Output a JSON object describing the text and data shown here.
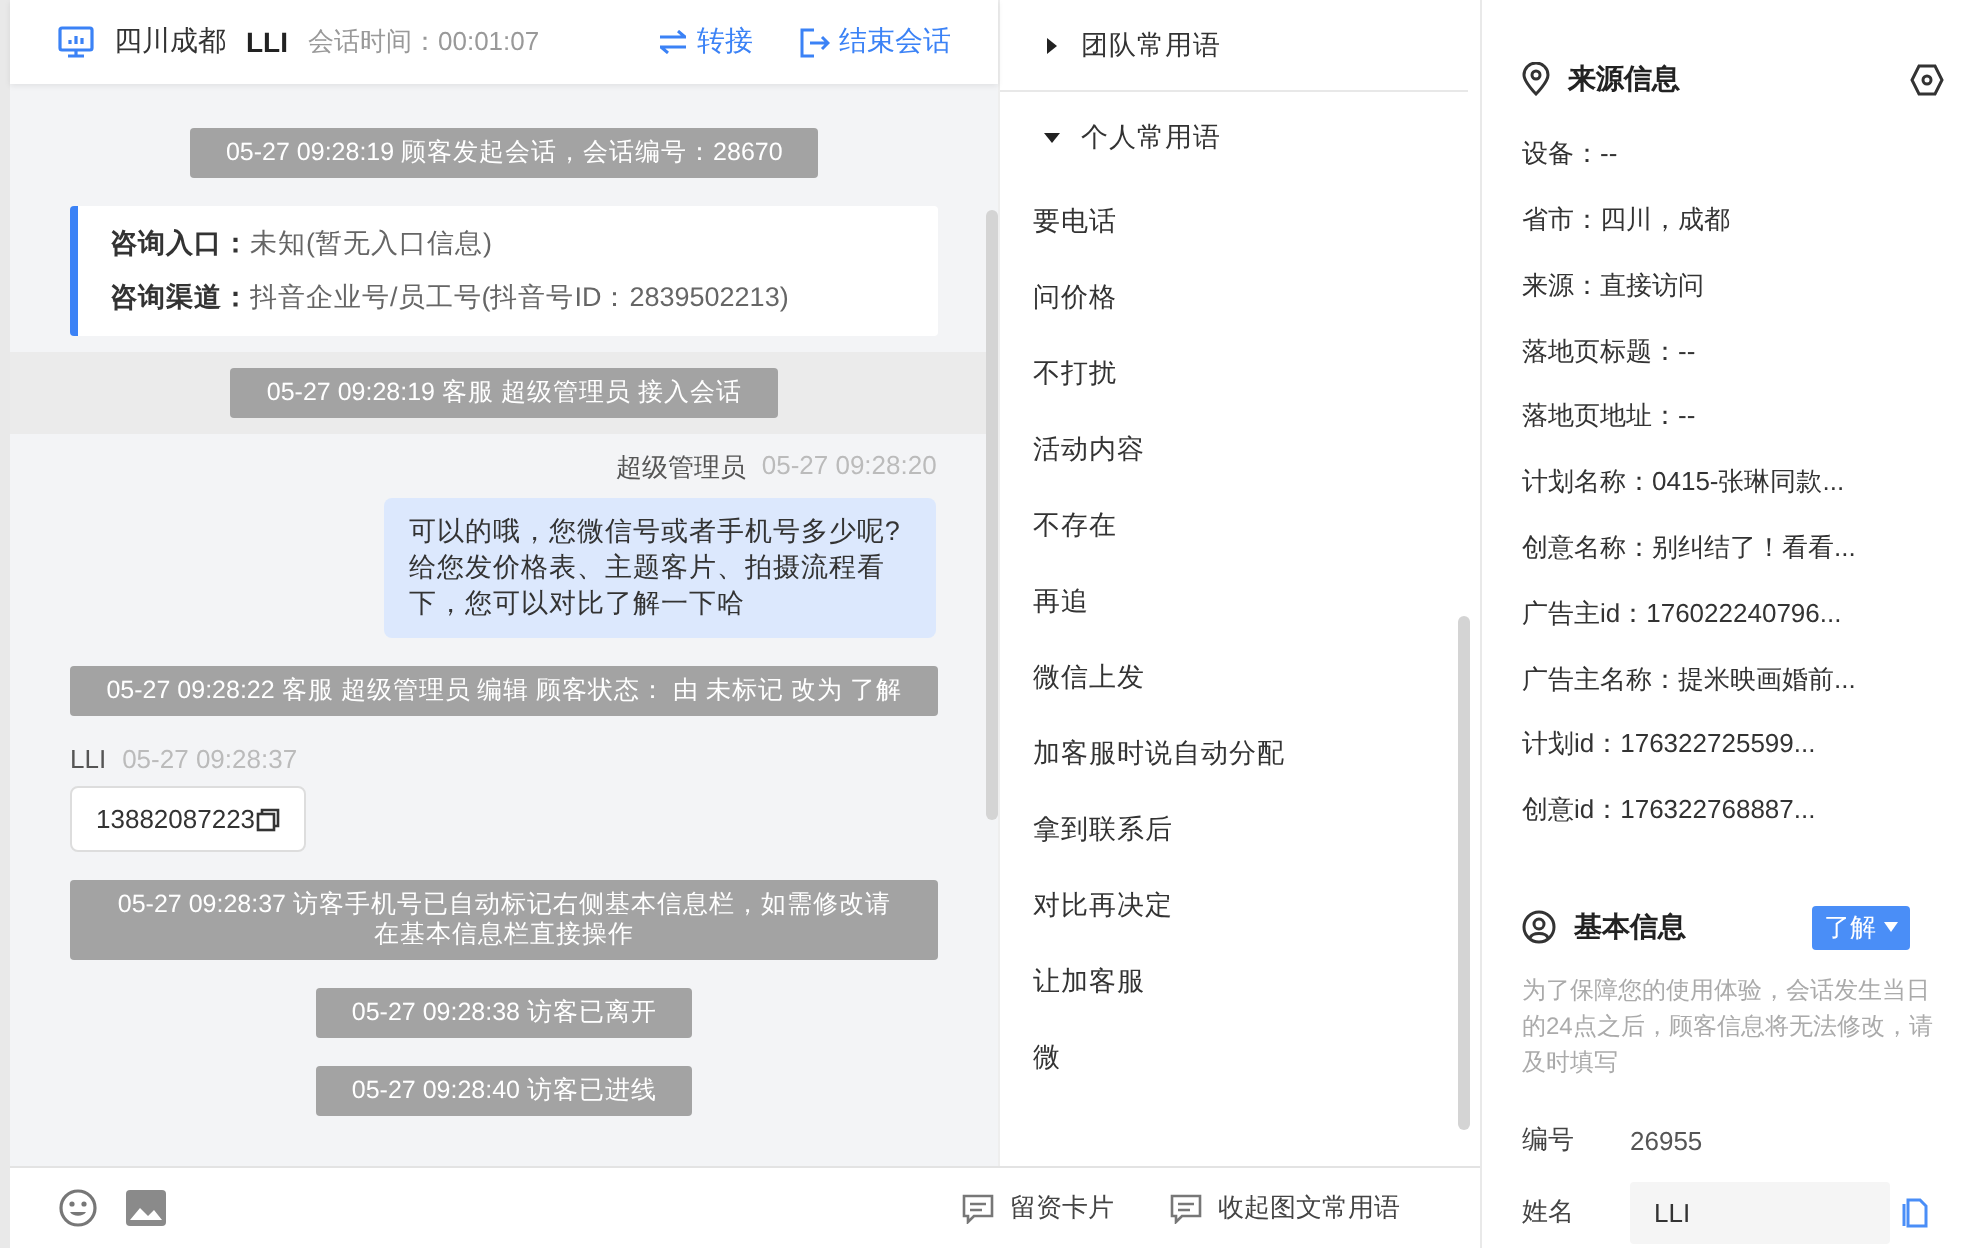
{
  "header": {
    "location": "四川成都",
    "name": "LLI",
    "session_time_label": "会话时间：",
    "session_time": "00:01:07",
    "actions": [
      {
        "kind": "transfer",
        "label": "转接"
      },
      {
        "kind": "end",
        "label": "结束会话"
      }
    ]
  },
  "messages": [
    {
      "kind": "system",
      "text": "05-27 09:28:19 顾客发起会话，会话编号：28670",
      "highlighted": false
    },
    {
      "kind": "info_card",
      "rows": [
        {
          "label": "咨询入口：",
          "value": "未知(暂无入口信息)"
        },
        {
          "label": "咨询渠道：",
          "value": "抖音企业号/员工号(抖音号ID：2839502213)"
        }
      ]
    },
    {
      "kind": "system",
      "text": "05-27 09:28:19 客服 超级管理员 接入会话",
      "highlighted": true
    },
    {
      "kind": "agent",
      "sender": "超级管理员",
      "time": "05-27 09:28:20",
      "text": "可以的哦，您微信号或者手机号多少呢?给您发价格表、主题客片、拍摄流程看下，您可以对比了解一下哈"
    },
    {
      "kind": "system",
      "text": "05-27 09:28:22 客服 超级管理员 编辑 顾客状态： 由 未标记 改为 了解",
      "highlighted": false
    },
    {
      "kind": "visitor",
      "sender": "LLI",
      "time": "05-27 09:28:37",
      "text": "13882087223"
    },
    {
      "kind": "system",
      "text": "05-27 09:28:37 访客手机号已自动标记右侧基本信息栏，如需修改请在基本信息栏直接操作",
      "highlighted": false
    },
    {
      "kind": "system",
      "text": "05-27 09:28:38 访客已离开",
      "highlighted": false
    },
    {
      "kind": "system",
      "text": "05-27 09:28:40 访客已进线",
      "highlighted": false
    }
  ],
  "toolbar": {
    "buttons": [
      "留资卡片",
      "收起图文常用语"
    ]
  },
  "phrases": [
    {
      "label": "团队常用语",
      "expanded": false
    },
    {
      "label": "个人常用语",
      "expanded": true,
      "items": [
        "要电话",
        "问价格",
        "不打扰",
        "活动内容",
        "不存在",
        "再追",
        "微信上发",
        "加客服时说自动分配",
        "拿到联系后",
        "对比再决定",
        "让加客服",
        "微"
      ]
    }
  ],
  "source_info": {
    "title": "来源信息",
    "fields": [
      "设备：--",
      "省市：四川，成都",
      "来源：直接访问",
      "落地页标题：--",
      "落地页地址：--",
      "计划名称：0415-张琳同款...",
      "创意名称：别纠结了！看看...",
      "广告主id：176022240796...",
      "广告主名称：提米映画婚前...",
      "计划id：176322725599...",
      "创意id：176322768887..."
    ]
  },
  "basic_info": {
    "title": "基本信息",
    "status": "了解",
    "notice": "为了保障您的使用体验，会话发生当日的24点之后，顾客信息将无法修改，请及时填写",
    "fields": [
      {
        "kind": "text",
        "label": "编号",
        "value": "26955"
      },
      {
        "kind": "input",
        "label": "姓名",
        "value": "LLI"
      }
    ]
  }
}
